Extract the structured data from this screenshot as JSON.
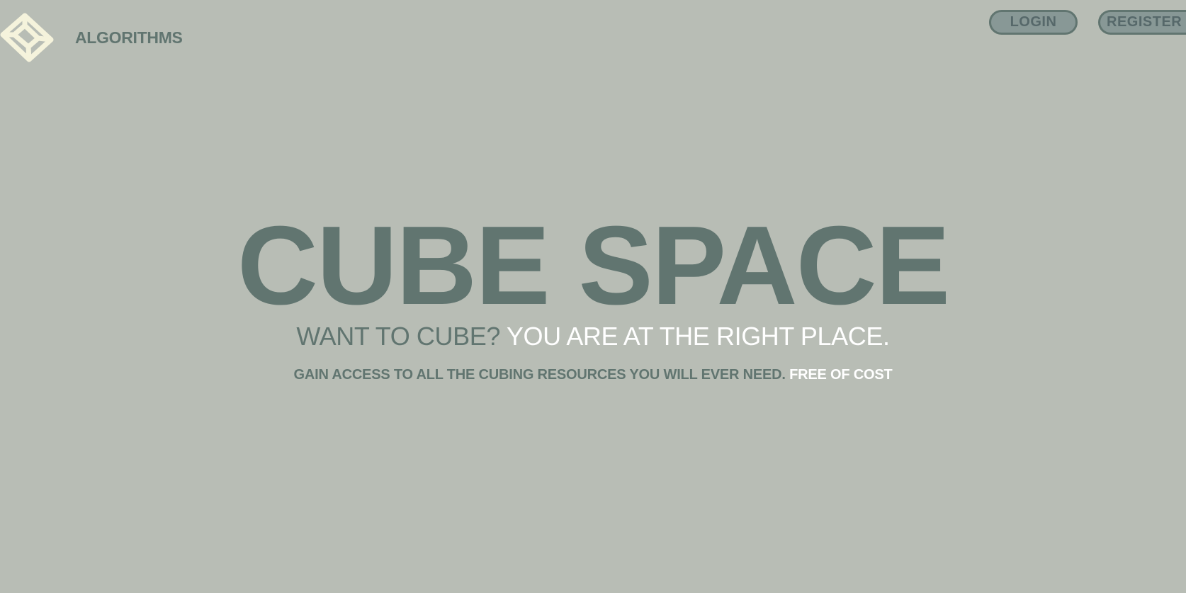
{
  "header": {
    "logo_icon": "cube-wireframe-icon",
    "nav_label": "ALGORITHMS",
    "login_label": "LOGIN",
    "register_label": "REGISTER"
  },
  "hero": {
    "title": "CUBE SPACE",
    "subtitle_dark": "WANT TO CUBE?",
    "subtitle_light": "YOU ARE AT THE RIGHT PLACE.",
    "desc_dark": "GAIN ACCESS TO ALL THE CUBING RESOURCES YOU WILL EVER NEED.",
    "desc_light": "FREE OF COST"
  },
  "colors": {
    "background": "#b8bdb5",
    "primary_text": "#617570",
    "highlight_text": "#ffffff",
    "logo": "#f5f3dc",
    "button_fill": "#889896"
  }
}
